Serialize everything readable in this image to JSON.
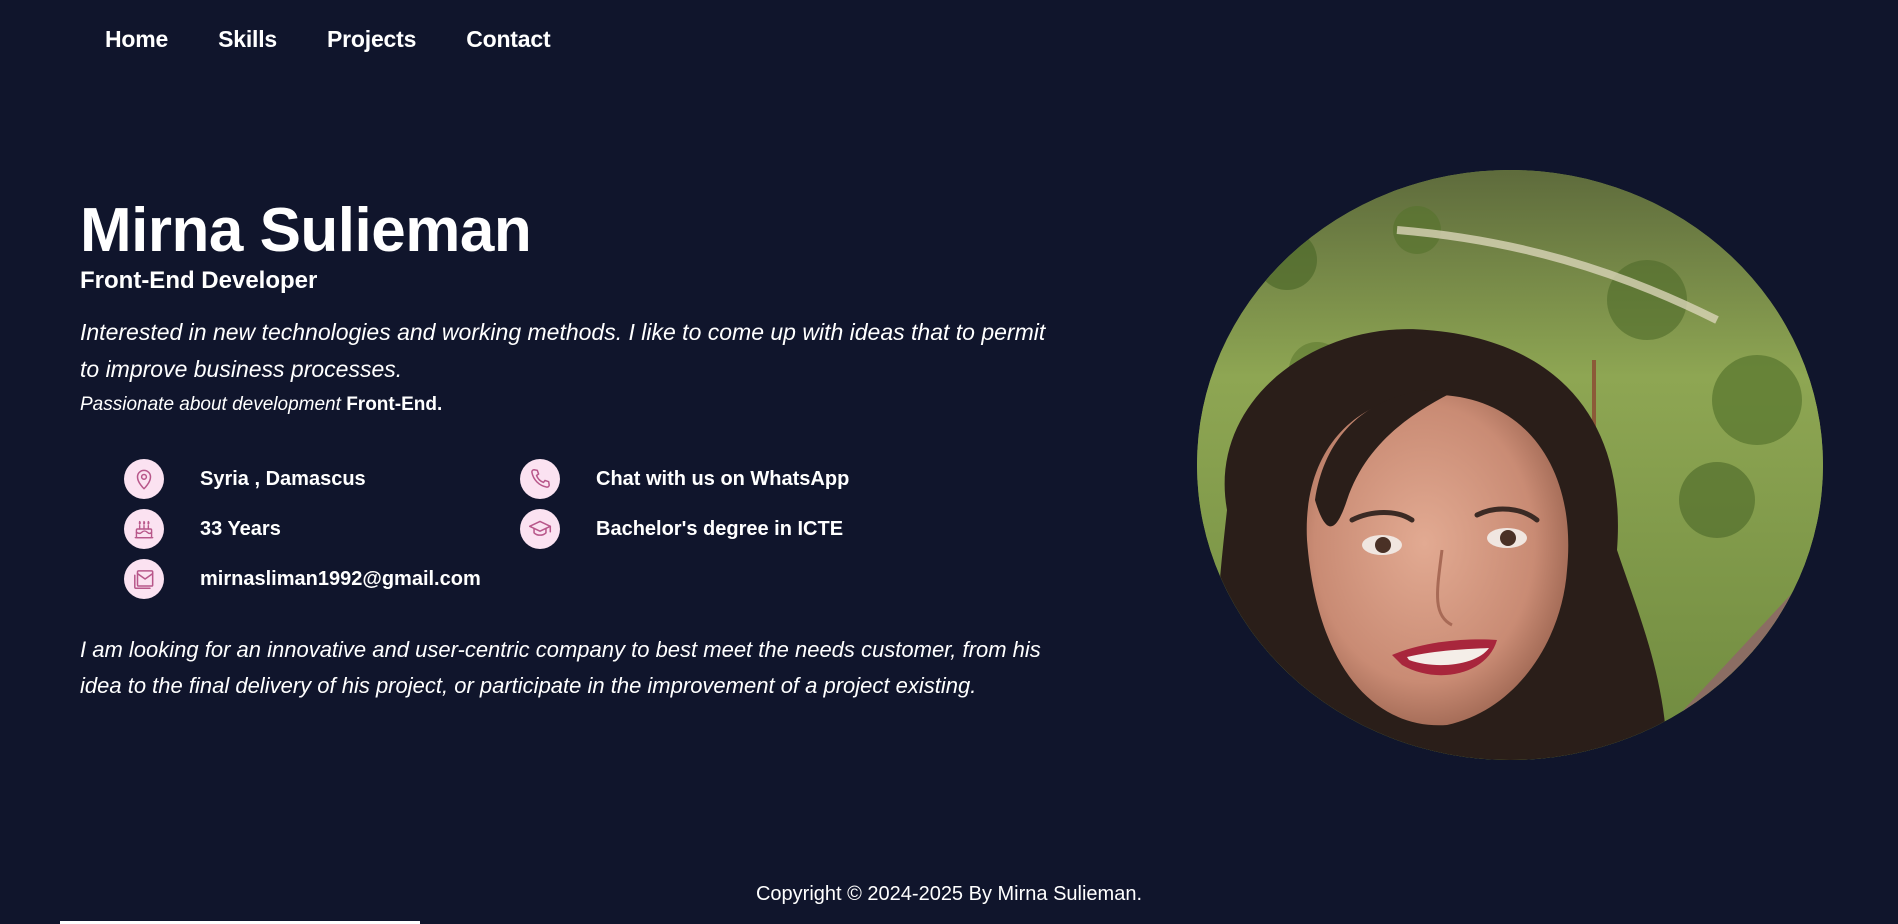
{
  "nav": {
    "items": [
      "Home",
      "Skills",
      "Projects",
      "Contact"
    ]
  },
  "hero": {
    "name": "Mirna Sulieman",
    "role": "Front-End Developer",
    "intro": "Interested in new technologies and working methods. I like to come up with ideas that to permit to improve business processes.",
    "passion_prefix": "Passionate about development",
    "passion_bold": "Front-End."
  },
  "facts": {
    "location": "Syria , Damascus",
    "contact": "Chat with us on WhatsApp",
    "age": "33 Years",
    "degree": "Bachelor's degree in ICTE",
    "email": "mirnasliman1992@gmail.com",
    "icons": [
      "location-pin-icon",
      "phone-icon",
      "birthday-cake-icon",
      "graduation-cap-icon",
      "mail-icon"
    ],
    "icon_bg_color": "#fbe2f1",
    "icon_stroke_color": "#b8578a"
  },
  "closing": "I am looking for an innovative and user-centric company to best meet the needs customer, from his idea to the final delivery of his project, or participate in the improvement of a project existing.",
  "footer": {
    "copyright": "Copyright © 2024-2025 By Mirna Sulieman."
  },
  "colors": {
    "background": "#10152c",
    "text": "#ffffff"
  }
}
